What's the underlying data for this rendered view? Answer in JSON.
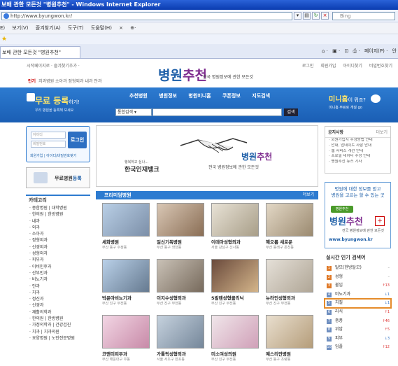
{
  "window": {
    "title": "보배 관한 모든것 \"병원추천\" - Windows Internet Explorer"
  },
  "address": {
    "url": "http://www.byungwon.kr/",
    "search_placeholder": "Bing"
  },
  "menu": [
    "E)",
    "보기(V)",
    "즐겨찾기(A)",
    "도구(T)",
    "도움말(H)",
    "×",
    "⊕·"
  ],
  "tab": {
    "label": "보배 관한 모든것 \"병원추천\""
  },
  "tools": [
    "⌂ ·",
    "▣ ·",
    "⊡",
    "⎙ ·",
    "페이지(P) ·",
    "안"
  ],
  "page": {
    "toplinks_left": "시작페이지로 · 즐겨찾기추가 ·",
    "toplinks_right": [
      "로그인",
      "회원가입",
      "아이디찾기",
      "비밀번호찾기"
    ],
    "logo_main": "병원",
    "logo_accent": "추천",
    "logo_sub": "전국 병원정보에 관한 모든것",
    "fav_label": "인기",
    "fav_text": "치과병원 소아과 정형외과 내과 안과",
    "nav": [
      "추천병원",
      "병원정보",
      "병원미니홈",
      "쿠폰정보",
      "지도검색"
    ],
    "free_reg_big": "무료 등록",
    "free_reg_suffix": "하기!",
    "free_reg_sub": "우리 병원을 등록해 보세요",
    "category_select": "통합검색",
    "search_button": "검색",
    "mini_title": "미니홈",
    "mini_suffix": "이 뭐죠?",
    "mini_sub": "미니홈 무료로 개설 go"
  },
  "login": {
    "id_placeholder": "아이디",
    "pw_placeholder": "비밀번호",
    "button": "로그인",
    "links": "회원가입 | 아이디/비밀번호찾기"
  },
  "free_hospital": {
    "label": "무료병원",
    "accent": "등록"
  },
  "category": {
    "title": "카테고리",
    "items": [
      "· 종합병원 | 대학병원",
      "· 한의원 | 한방병원",
      "· 내과",
      "· 외과",
      "· 소아과",
      "· 정형외과",
      "· 신경외과",
      "· 성형외과",
      "· 피부과",
      "· 이비인후과",
      "· 산부인과",
      "· 비뇨기과",
      "· 안과",
      "· 치과",
      "· 정신과",
      "· 신경과",
      "· 재활의학과",
      "· 한의원 | 한방병원",
      "· 가정의학과 | 건강검진",
      "· 치과 | 치과의원",
      "· 요양병원 | 노인전문병원"
    ]
  },
  "ad": {
    "brand": "한국인재뱅크",
    "brand_sub": "행복하고 싶나...",
    "title_main": "병원",
    "title_accent": "추천",
    "sub": "전국 병원정보에 관한 모든것"
  },
  "premium": {
    "title": "프리미엄병원",
    "more": "더보기",
    "cards": [
      {
        "name": "세화병원",
        "addr": "부산 동구 수정동"
      },
      {
        "name": "일신기독병원",
        "addr": "부산 동구 좌천동"
      },
      {
        "name": "이데아성형외과",
        "addr": "서울 강남구 신사동"
      },
      {
        "name": "해오름 새로운",
        "addr": "부산 동래구 온천동"
      },
      {
        "name": "박윤아비뇨기과",
        "addr": "부산 진구 부전동"
      },
      {
        "name": "이지수성형외과",
        "addr": "부산 진구 부전동"
      },
      {
        "name": "S발렌성형클리닉",
        "addr": "부산 진구 부전동"
      },
      {
        "name": "뉴라인성형외과",
        "addr": "부산 진구 부전동"
      },
      {
        "name": "코앤미피부과",
        "addr": "부산 해운대구 우동"
      },
      {
        "name": "가톨릭성형외과",
        "addr": "서울 서초구 반포동"
      },
      {
        "name": "미소여성의원",
        "addr": "부산 진구 부전동"
      },
      {
        "name": "예스리안병원",
        "addr": "부산 동구 초량동"
      }
    ]
  },
  "notice": {
    "title": "공지사항",
    "more": "더보기",
    "items": [
      "· 회원가입시 수정방법 안내",
      "· 안내, 업데이트 사항 안내",
      "· 웹 서비스 개선 안내",
      "· 프로필 데이터 수정 안내",
      "· 병원추천 뉴스 기사"
    ]
  },
  "side_ad": {
    "line1": "병원에 대한 정보를 얻고",
    "line2": "병원을 고르는 할 수 있는 곳",
    "badge": "병원추천",
    "logo_main": "병원",
    "logo_accent": "추천",
    "sub": "전국 병원정보에 관한 모든것",
    "url": "www.byungwon.kr"
  },
  "ranking": {
    "title": "실시간 인기 검색어",
    "items": [
      {
        "n": "1",
        "word": "탈모(한방탈모)",
        "change": "–"
      },
      {
        "n": "2",
        "word": "성형",
        "change": "–"
      },
      {
        "n": "3",
        "word": "불임",
        "change": "↑13"
      },
      {
        "n": "4",
        "word": "비뇨기과",
        "change": "↓1"
      },
      {
        "n": "5",
        "word": "치질",
        "change": "↓1"
      },
      {
        "n": "6",
        "word": "라식",
        "change": "↑1"
      },
      {
        "n": "7",
        "word": "중풍",
        "change": "↑46"
      },
      {
        "n": "8",
        "word": "위암",
        "change": "↑5"
      },
      {
        "n": "9",
        "word": "피부",
        "change": "↓3"
      },
      {
        "n": "10",
        "word": "임플",
        "change": "↑12"
      }
    ]
  },
  "colors": {
    "brand_blue": "#1e5fa8",
    "brand_purple": "#7d2b8e",
    "banner": "#2d7bd0"
  }
}
